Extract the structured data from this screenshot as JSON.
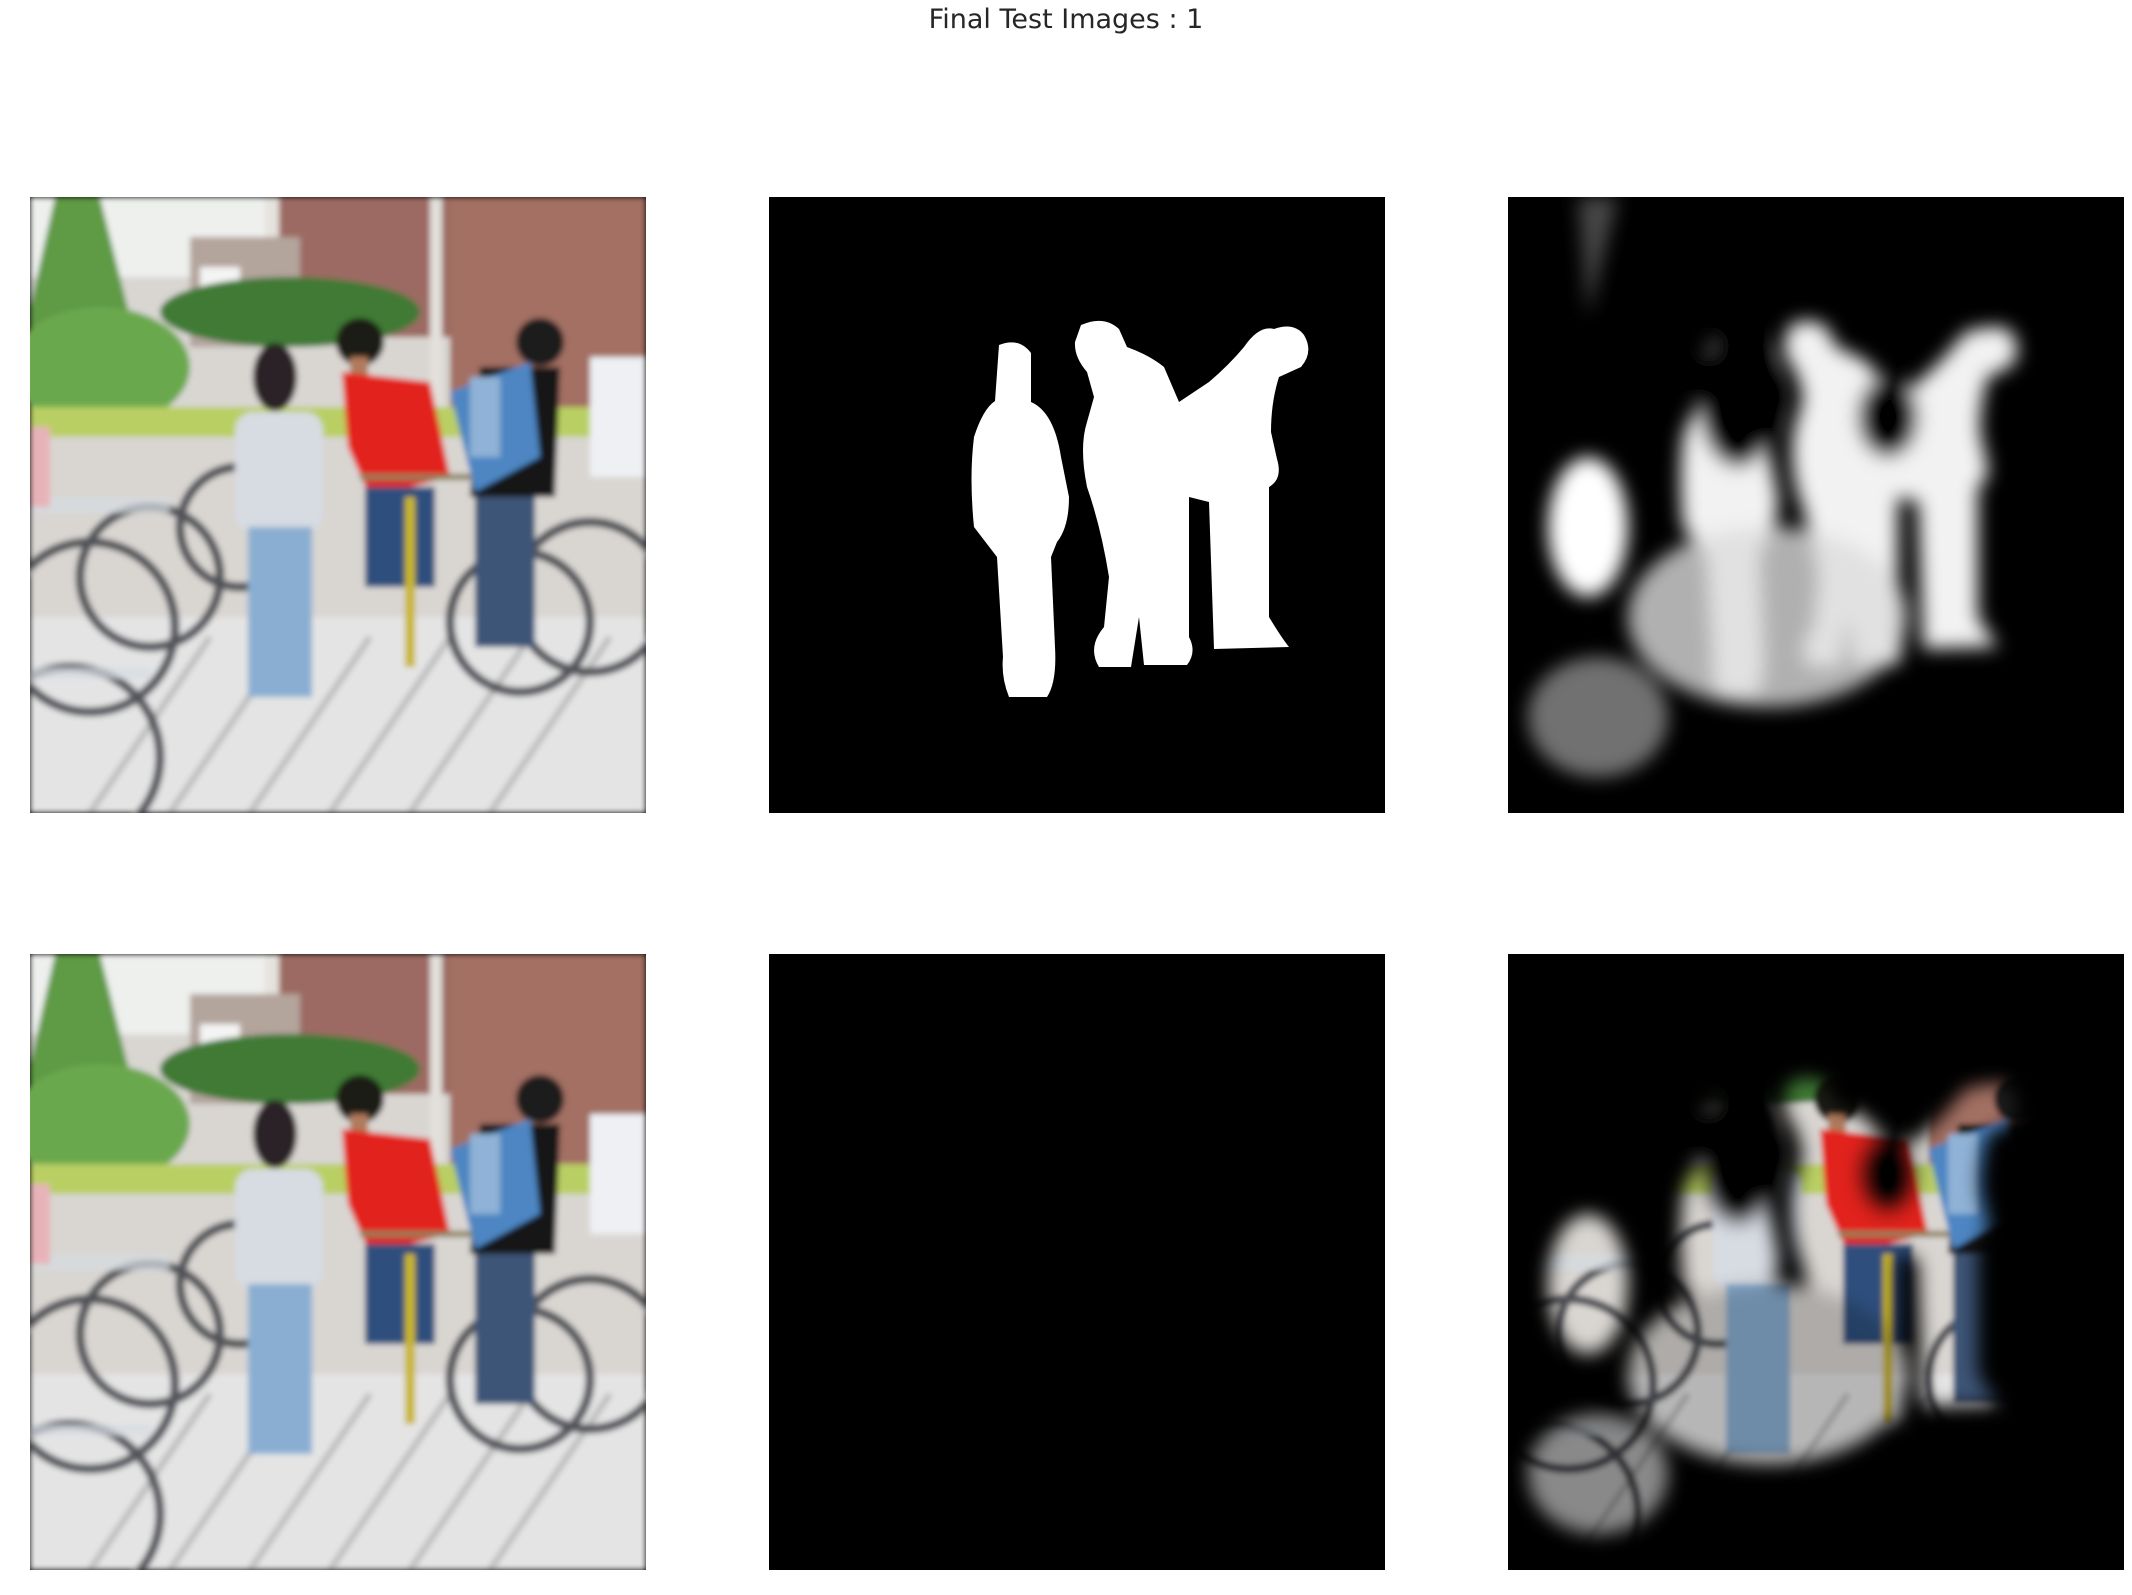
{
  "figure": {
    "title": "Final Test Images : 1"
  },
  "panels": [
    {
      "row": 1,
      "col": 1,
      "content": "input-photo"
    },
    {
      "row": 1,
      "col": 2,
      "content": "ground-truth-mask"
    },
    {
      "row": 1,
      "col": 3,
      "content": "predicted-mask"
    },
    {
      "row": 2,
      "col": 1,
      "content": "input-photo"
    },
    {
      "row": 2,
      "col": 2,
      "content": "ground-truth-masked-photo"
    },
    {
      "row": 2,
      "col": 3,
      "content": "predicted-masked-photo"
    }
  ],
  "colors": {
    "background": "#ffffff",
    "title_text": "#262626",
    "mask_fg": "#ffffff",
    "mask_bg": "#000000",
    "shirt_red": "#e2231f",
    "jacket_blue": "#4d86c3",
    "jeans_blue": "#7fa2c9",
    "bike_yellow": "#c9b521",
    "brick": "#9c6b62",
    "foliage": "#5b9a3f",
    "pavement": "#dcdcdc"
  }
}
